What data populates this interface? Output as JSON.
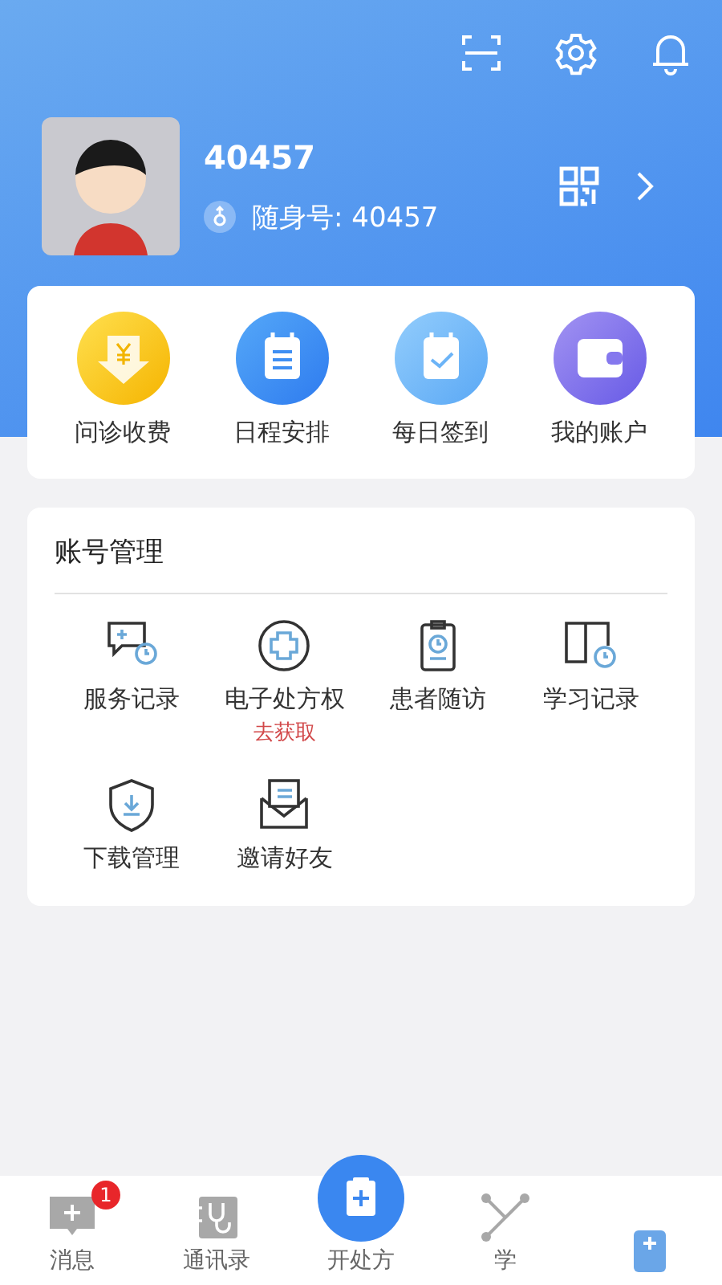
{
  "profile": {
    "name": "40457",
    "id_label": "随身号: 40457"
  },
  "quick_actions": [
    {
      "label": "问诊收费",
      "kind": "fee"
    },
    {
      "label": "日程安排",
      "kind": "schedule"
    },
    {
      "label": "每日签到",
      "kind": "checkin"
    },
    {
      "label": "我的账户",
      "kind": "wallet"
    }
  ],
  "account_section": {
    "title": "账号管理",
    "items": [
      {
        "label": "服务记录",
        "kind": "service"
      },
      {
        "label": "电子处方权",
        "kind": "prescription",
        "link": "去获取"
      },
      {
        "label": "患者随访",
        "kind": "followup"
      },
      {
        "label": "学习记录",
        "kind": "study"
      },
      {
        "label": "下载管理",
        "kind": "download"
      },
      {
        "label": "邀请好友",
        "kind": "invite"
      }
    ]
  },
  "bottom_nav": [
    {
      "label": "消息",
      "kind": "message",
      "badge": "1"
    },
    {
      "label": "通讯录",
      "kind": "contacts"
    },
    {
      "label": "开处方",
      "kind": "center"
    },
    {
      "label": "学",
      "kind": "academic"
    },
    {
      "kind": "kit"
    }
  ]
}
